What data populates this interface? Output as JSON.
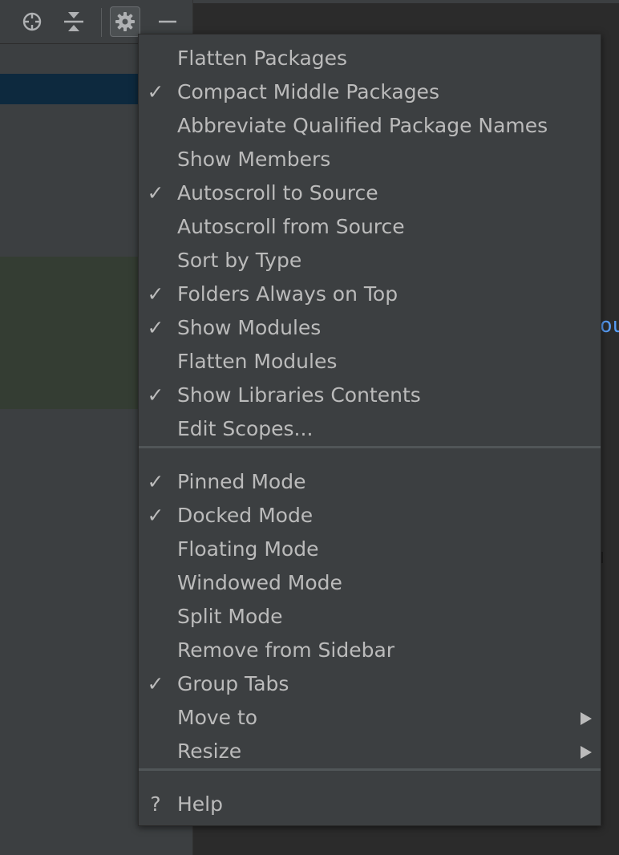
{
  "toolbar": {
    "buttons": [
      {
        "icon": "locate-icon"
      },
      {
        "icon": "collapse-all-icon"
      },
      {
        "icon": "gear-icon",
        "active": true
      },
      {
        "icon": "minimize-icon"
      }
    ]
  },
  "editor": {
    "visible_fragment": "ou"
  },
  "menu": {
    "groups": [
      [
        {
          "label": "Flatten Packages",
          "checked": false
        },
        {
          "label": "Compact Middle Packages",
          "checked": true
        },
        {
          "label": "Abbreviate Qualified Package Names",
          "checked": false
        },
        {
          "label": "Show Members",
          "checked": false
        },
        {
          "label": "Autoscroll to Source",
          "checked": true
        },
        {
          "label": "Autoscroll from Source",
          "checked": false
        },
        {
          "label": "Sort by Type",
          "checked": false
        },
        {
          "label": "Folders Always on Top",
          "checked": true
        },
        {
          "label": "Show Modules",
          "checked": true
        },
        {
          "label": "Flatten Modules",
          "checked": false
        },
        {
          "label": "Show Libraries Contents",
          "checked": true
        },
        {
          "label": "Edit Scopes...",
          "checked": false
        }
      ],
      [
        {
          "label": "Pinned Mode",
          "checked": true
        },
        {
          "label": "Docked Mode",
          "checked": true
        },
        {
          "label": "Floating Mode",
          "checked": false
        },
        {
          "label": "Windowed Mode",
          "checked": false
        },
        {
          "label": "Split Mode",
          "checked": false
        },
        {
          "label": "Remove from Sidebar",
          "checked": false
        },
        {
          "label": "Group Tabs",
          "checked": true
        },
        {
          "label": "Move to",
          "checked": false,
          "submenu": true
        },
        {
          "label": "Resize",
          "checked": false,
          "submenu": true
        }
      ],
      [
        {
          "label": "Help",
          "checked": false,
          "mark": "?"
        }
      ]
    ],
    "check_glyph": "✓"
  }
}
